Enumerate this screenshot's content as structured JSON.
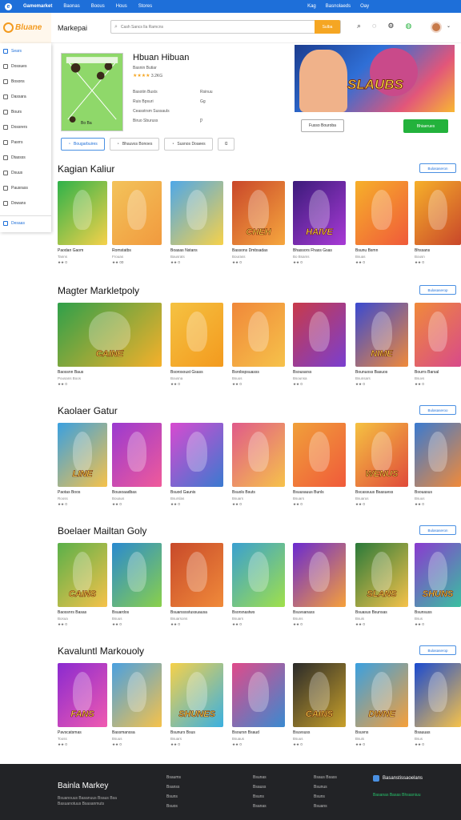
{
  "topbar": {
    "brand": "Gamemarket",
    "links": [
      "Baonas",
      "Boous",
      "Hous",
      "Stores"
    ],
    "right_links": [
      "Kag",
      "Basnolaeds",
      "Oay"
    ]
  },
  "header": {
    "brand": "Bluane",
    "title": "Markepai",
    "search_placeholder": "Cash Sancs lla Ramcns",
    "search_button": "Sulba"
  },
  "sidebar": {
    "items": [
      {
        "label": "Sears",
        "active": true
      },
      {
        "label": "Dossues",
        "active": false
      },
      {
        "label": "Bosons",
        "active": false
      },
      {
        "label": "Dassara",
        "active": false
      },
      {
        "label": "Bours",
        "active": false
      },
      {
        "label": "Dossrers",
        "active": false
      },
      {
        "label": "Pasrrs",
        "active": false
      },
      {
        "label": "Dtassss",
        "active": false
      },
      {
        "label": "Dsuus",
        "active": false
      },
      {
        "label": "Pausrass",
        "active": false
      },
      {
        "label": "Dowans",
        "active": false
      },
      {
        "label": "Desaas",
        "active": true
      }
    ]
  },
  "hero": {
    "thumb_label": "Bo Ba",
    "title": "Hbuan Hibuan",
    "subtitle": "Basnin Butiar",
    "stars": "★★★★",
    "rating": "3.2KG",
    "meta": [
      [
        "Basotin Busts",
        "Rsinuu"
      ],
      [
        "Ruis Bpsuri",
        "Gg"
      ],
      [
        "Ceasstrsm Sussauls",
        ""
      ],
      [
        "Biruo Sburuss",
        "Ƿ"
      ]
    ],
    "banner_title": "SLAUBS",
    "follow_button": "Fusso Bouroba",
    "get_button": "Bhiaerues",
    "tabs": [
      "Bougarbuires",
      "Bhauvss Bonoes",
      "Susnos Doaees",
      "Ɑ"
    ]
  },
  "sections": [
    {
      "title": "Kagian Kaliur",
      "see_all": "Bulasaseron",
      "cards": [
        {
          "name": "Paodan Gaom",
          "dev": "Tanns",
          "rating": "★★ 0",
          "art": "",
          "c1": "#2fb24a",
          "c2": "#f6d14a"
        },
        {
          "name": "Romstatbs",
          "dev": "Frouas",
          "rating": "★★ 00",
          "art": "",
          "c1": "#f3c35a",
          "c2": "#f19a3e"
        },
        {
          "name": "Boasas Nstans",
          "dev": "Bausrats",
          "rating": "★★ 0",
          "art": "",
          "c1": "#4fa8e8",
          "c2": "#f6d14a"
        },
        {
          "name": "Bassons Dmbsadas",
          "dev": "Bourass",
          "rating": "★★ 0",
          "art": "CHEH",
          "c1": "#c9472a",
          "c2": "#f6a73e"
        },
        {
          "name": "Bhassors Fhass Gsas",
          "dev": "Bo Bsams",
          "rating": "★★ 0",
          "art": "HAIVE",
          "c1": "#3b1b7a",
          "c2": "#a83ad6"
        },
        {
          "name": "Bsunu Bsmn",
          "dev": "Bsuas",
          "rating": "★★ 0",
          "art": "",
          "c1": "#f6b02a",
          "c2": "#f05a3a"
        },
        {
          "name": "Bhssans",
          "dev": "Bousn",
          "rating": "★★ 0",
          "art": "",
          "c1": "#f6b02a",
          "c2": "#c9472a"
        }
      ]
    },
    {
      "title": "Magter Markletpoly",
      "see_all": "Bulasaserop",
      "cards": [
        {
          "name": "Baossnn Baus",
          "dev": "Pousans Boos",
          "rating": "★★ 0",
          "art": "CAINE",
          "c1": "#2fa04a",
          "c2": "#f6b02a"
        },
        {
          "name": "Bsorosoust Gsass",
          "dev": "Bousna",
          "rating": "★★ 0",
          "art": "",
          "c1": "#f5c242",
          "c2": "#f39a1e"
        },
        {
          "name": "Bsrobspsuasss",
          "dev": "Bsuos",
          "rating": "★★ 0",
          "art": "",
          "c1": "#f0883a",
          "c2": "#f6c24a"
        },
        {
          "name": "Bsousarss",
          "dev": "Bsounsa",
          "rating": "★★ 0",
          "art": "",
          "c1": "#c83a4a",
          "c2": "#7a3fd0"
        },
        {
          "name": "Bounuoss Basuos",
          "dev": "Bsunsars",
          "rating": "★★ 0",
          "art": "NIME",
          "c1": "#3a4ad0",
          "c2": "#f08a3a"
        },
        {
          "name": "Bourrs Barsal",
          "dev": "Bsuvs",
          "rating": "★★ 0",
          "art": "",
          "c1": "#f08a3a",
          "c2": "#d84a8a"
        }
      ]
    },
    {
      "title": "Kaolaer Gatur",
      "see_all": "Bulasaseroo",
      "cards": [
        {
          "name": "Paotas Boos",
          "dev": "Rooss",
          "rating": "★★ 0",
          "art": "LINE",
          "c1": "#3aa0e0",
          "c2": "#f6c24a"
        },
        {
          "name": "Bousoaadbas",
          "dev": "Bouaus",
          "rating": "★★ 0",
          "art": "",
          "c1": "#9a3ad0",
          "c2": "#f05a9a"
        },
        {
          "name": "Bsuod Gaunis",
          "dev": "Bsurslas",
          "rating": "★★ 0",
          "art": "",
          "c1": "#d84ad0",
          "c2": "#3a7ad0"
        },
        {
          "name": "Bsuols Bsuts",
          "dev": "Bsuars",
          "rating": "★★ 0",
          "art": "",
          "c1": "#e05a8a",
          "c2": "#f6c24a"
        },
        {
          "name": "Bsuusauus Bunls",
          "dev": "Bsuars",
          "rating": "★★ 0",
          "art": "",
          "c1": "#f0a03a",
          "c2": "#f05a3a"
        },
        {
          "name": "Bscassuus Bsasuess",
          "dev": "Bsuarus",
          "rating": "★★ 0",
          "art": "WENUS",
          "c1": "#f5c242",
          "c2": "#e04a3a"
        },
        {
          "name": "Bsouasus",
          "dev": "Bsuus",
          "rating": "★★ 0",
          "art": "",
          "c1": "#3a7ad0",
          "c2": "#f08a3a"
        }
      ]
    },
    {
      "title": "Boelaer Mailtan Goly",
      "see_all": "Bulasaseron",
      "cards": [
        {
          "name": "Baossnrs Basas",
          "dev": "Bosua",
          "rating": "★★ 0",
          "art": "CAINS",
          "c1": "#5ab04a",
          "c2": "#f6c24a"
        },
        {
          "name": "Bsuardos",
          "dev": "Bsuus",
          "rating": "★★ 0",
          "art": "",
          "c1": "#2a8ad0",
          "c2": "#8ad04a"
        },
        {
          "name": "Bsuarsssstussuausa",
          "dev": "Bsuarsons",
          "rating": "★★ 0",
          "art": "",
          "c1": "#c84a2a",
          "c2": "#f08a3a"
        },
        {
          "name": "Bsorsnastws",
          "dev": "Bsuars",
          "rating": "★★ 0",
          "art": "",
          "c1": "#3aa0d0",
          "c2": "#a0e04a"
        },
        {
          "name": "Bsuvsanass",
          "dev": "Bsuns",
          "rating": "★★ 0",
          "art": "",
          "c1": "#6a2ad0",
          "c2": "#f6a03a"
        },
        {
          "name": "Bsuasus Bsunsas",
          "dev": "Bsuis",
          "rating": "★★ 0",
          "art": "SLANS",
          "c1": "#2a7a3a",
          "c2": "#f6c24a"
        },
        {
          "name": "Bsunsuss",
          "dev": "Bsus",
          "rating": "★★ 0",
          "art": "SHUNS",
          "c1": "#8a3ad0",
          "c2": "#3ac0a0"
        }
      ]
    },
    {
      "title": "Kavaluntl Markouoly",
      "see_all": "Bulasaserop",
      "cards": [
        {
          "name": "Pavscatsmas",
          "dev": "Tooss",
          "rating": "★★ 0",
          "art": "FANS",
          "c1": "#8a2ad0",
          "c2": "#f05ab0"
        },
        {
          "name": "Bassmanssa",
          "dev": "Bsuus",
          "rating": "★★ 0",
          "art": "",
          "c1": "#4aa0e0",
          "c2": "#f6c24a"
        },
        {
          "name": "Bsunurs Bsus",
          "dev": "Bsuars",
          "rating": "★★ 0",
          "art": "SHUNES",
          "c1": "#f6d14a",
          "c2": "#3ab0e0"
        },
        {
          "name": "Bsoursn Bsaud",
          "dev": "Bsuaus",
          "rating": "★★ 0",
          "art": "",
          "c1": "#e04a8a",
          "c2": "#3a8ad0"
        },
        {
          "name": "Bsuvsuss",
          "dev": "Bsuus",
          "rating": "★★ 0",
          "art": "CAINS",
          "c1": "#2a2a2a",
          "c2": "#c8a02a"
        },
        {
          "name": "Bsuvns",
          "dev": "Bsuis",
          "rating": "★★ 0",
          "art": "DWNE",
          "c1": "#3aa0e0",
          "c2": "#f6a03a"
        },
        {
          "name": "Bsauuas",
          "dev": "Bsus",
          "rating": "★★ 0",
          "art": "",
          "c1": "#1a4ad0",
          "c2": "#f6c24a"
        }
      ]
    }
  ],
  "footer": {
    "brand": "Bainla Markey",
    "sub": "Bsuanouus Basanuus Bsaus Bsa Basuanotuus Bsasanmuts",
    "col1": [
      "Bsaums",
      "Bsanss",
      "Bsuns",
      "Bsuos"
    ],
    "col2": [
      "Bsunas",
      "Bsauss",
      "Bsuns",
      "Bsanas"
    ],
    "col3": [
      "Bsaus Bsass",
      "Bsunus",
      "Bsuns",
      "Bsuans"
    ],
    "right_title": "Basanstissaoelans",
    "right_links": "Basanas Basas Bhsasniuu"
  }
}
